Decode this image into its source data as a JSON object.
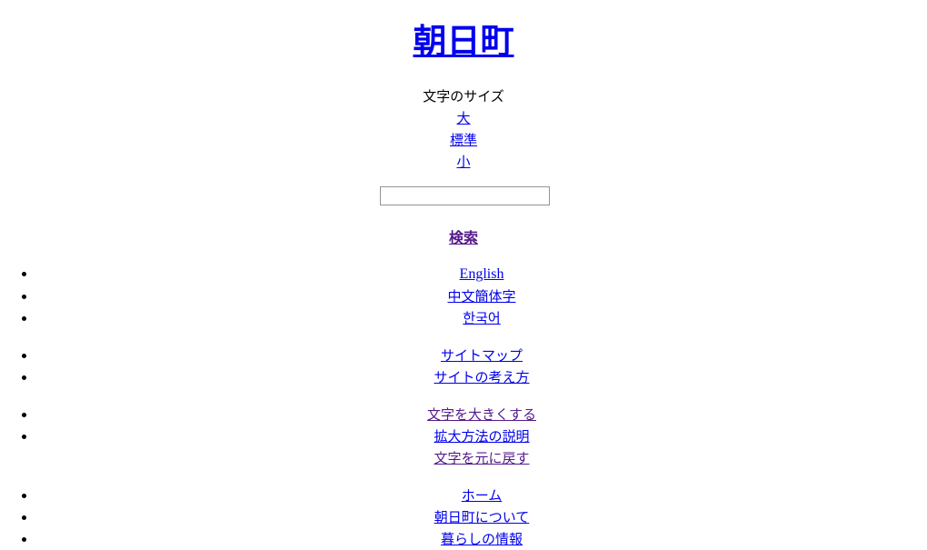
{
  "site": {
    "title": "朝日町"
  },
  "font_size": {
    "label": "文字のサイズ",
    "options": [
      {
        "label": "大"
      },
      {
        "label": "標準"
      },
      {
        "label": "小"
      }
    ]
  },
  "search": {
    "value": "",
    "placeholder": "",
    "submit_label": "検索"
  },
  "nav_language": {
    "items": [
      {
        "label": "English",
        "script": "latin",
        "state": "link"
      },
      {
        "label": "中文簡体字",
        "script": "cjk",
        "state": "link"
      },
      {
        "label": "한국어",
        "script": "cjk",
        "state": "link"
      }
    ]
  },
  "nav_site": {
    "items": [
      {
        "label": "サイトマップ",
        "state": "link"
      },
      {
        "label": "サイトの考え方",
        "state": "link"
      }
    ]
  },
  "nav_textsize": {
    "items": [
      {
        "label": "文字を大きくする",
        "state": "visited",
        "bullet": true
      },
      {
        "label": "拡大方法の説明",
        "state": "link",
        "bullet": true
      },
      {
        "label": "文字を元に戻す",
        "state": "visited",
        "bullet": false
      }
    ]
  },
  "nav_main": {
    "items": [
      {
        "label": "ホーム",
        "state": "link"
      },
      {
        "label": "朝日町について",
        "state": "link"
      },
      {
        "label": "暮らしの情報",
        "state": "link"
      }
    ]
  },
  "colors": {
    "link": "#0000ee",
    "visited": "#551a8b",
    "text": "#000000",
    "background": "#ffffff",
    "input_border": "#949494"
  }
}
